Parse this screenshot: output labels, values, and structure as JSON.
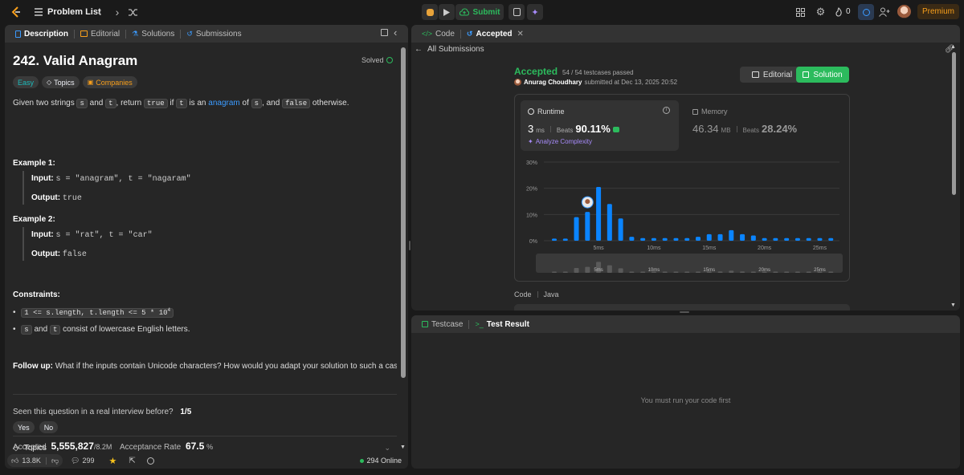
{
  "topbar": {
    "problem_list": "Problem List",
    "submit": "Submit",
    "streak": "0",
    "premium": "Premium"
  },
  "left": {
    "tabs": [
      "Description",
      "Editorial",
      "Solutions",
      "Submissions"
    ],
    "title": "242. Valid Anagram",
    "solved": "Solved",
    "tags": {
      "difficulty": "Easy",
      "topics": "Topics",
      "companies": "Companies"
    },
    "description": {
      "p1": "Given two strings",
      "s": "s",
      "and": "and",
      "t": "t",
      "return": ", return",
      "true": "true",
      "if": "if",
      "is_an": "is an",
      "anagram": "anagram",
      "of": "of",
      "comma_and": ", and",
      "false": "false",
      "otherwise": "otherwise."
    },
    "example1": {
      "title": "Example 1:",
      "input_label": "Input:",
      "input": "s = \"anagram\", t = \"nagaram\"",
      "output_label": "Output:",
      "output": "true"
    },
    "example2": {
      "title": "Example 2:",
      "input_label": "Input:",
      "input": "s = \"rat\", t = \"car\"",
      "output_label": "Output:",
      "output": "false"
    },
    "constraints": {
      "title": "Constraints:",
      "c1_code": "1 <= s.length, t.length <= 5 * 10",
      "c1_exp": "4",
      "c2_s": "s",
      "c2_and": "and",
      "c2_t": "t",
      "c2_rest": "consist of lowercase English letters."
    },
    "followup": {
      "label": "Follow up:",
      "text": "What if the inputs contain Unicode characters? How would you adapt your solution to such a case?"
    },
    "interview": {
      "question": "Seen this question in a real interview before?",
      "count": "1/5",
      "yes": "Yes",
      "no": "No"
    },
    "stats": {
      "accepted_label": "Accepted",
      "accepted_value": "5,555,827",
      "accepted_total": "/8.2M",
      "rate_label": "Acceptance Rate",
      "rate_value": "67.5",
      "rate_unit": "%"
    },
    "topics_section": "Topics",
    "footer": {
      "likes": "13.8K",
      "comments": "299",
      "online": "294 Online"
    }
  },
  "right": {
    "tabs": {
      "code": "Code",
      "accepted": "Accepted"
    },
    "all_submissions": "All Submissions",
    "result": {
      "status": "Accepted",
      "testcases": "54 / 54 testcases passed",
      "user": "Anurag Choudhary",
      "submitted": "submitted at Dec 13, 2025 20:52",
      "editorial": "Editorial",
      "solution": "Solution"
    },
    "runtime": {
      "label": "Runtime",
      "value": "3",
      "unit": "ms",
      "beats_label": "Beats",
      "beats": "90.11%",
      "analyze": "Analyze Complexity"
    },
    "memory": {
      "label": "Memory",
      "value": "46.34",
      "unit": "MB",
      "beats_label": "Beats",
      "beats": "28.24%"
    },
    "code_lang": {
      "code": "Code",
      "lang": "Java"
    },
    "bottom_tabs": {
      "testcase": "Testcase",
      "result": "Test Result"
    },
    "empty_msg": "You must run your code first"
  },
  "chart_data": {
    "type": "bar",
    "y_ticks": [
      "30%",
      "20%",
      "10%",
      "0%"
    ],
    "x_ticks": [
      "5ms",
      "10ms",
      "15ms",
      "20ms",
      "25ms"
    ],
    "ylim": [
      0,
      30
    ],
    "values": [
      0.8,
      0.8,
      9,
      11,
      20.5,
      14,
      8.5,
      1.5,
      1,
      1,
      1,
      1,
      1,
      1.5,
      2.5,
      2.5,
      4,
      2.5,
      2,
      1,
      1,
      1,
      1,
      1,
      1,
      1
    ],
    "highlight_index": 3,
    "accent": "#0a84ff"
  }
}
